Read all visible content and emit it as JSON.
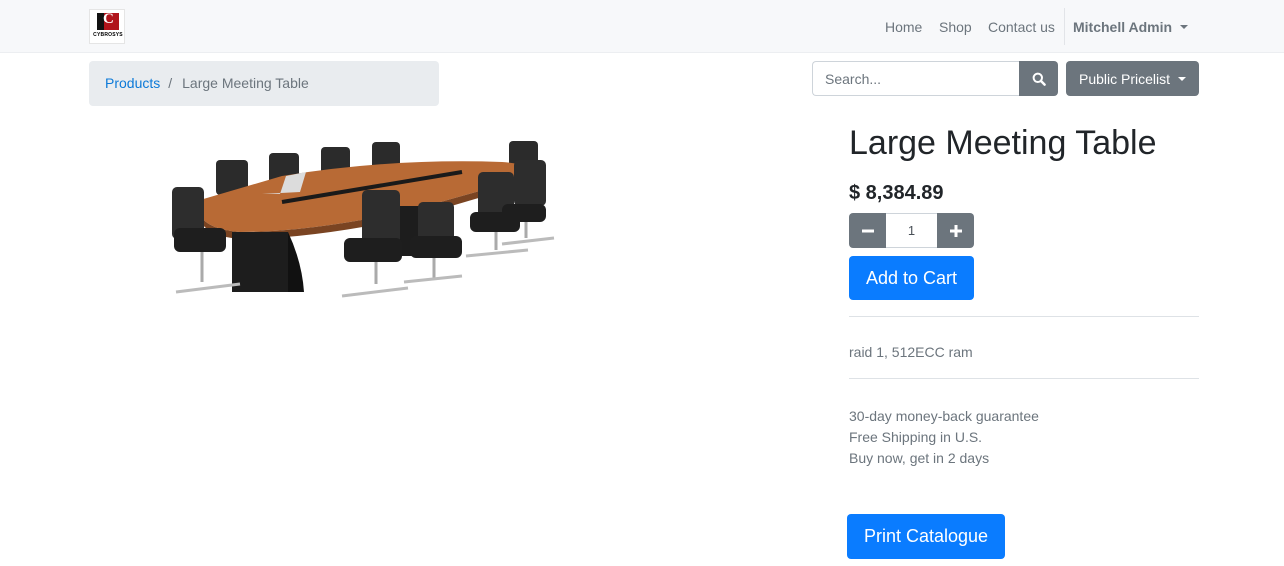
{
  "navbar": {
    "logo_text": "CYBROSYS",
    "links": [
      {
        "label": "Home"
      },
      {
        "label": "Shop"
      },
      {
        "label": "Contact us"
      }
    ],
    "user_name": "Mitchell Admin"
  },
  "breadcrumb": {
    "parent": "Products",
    "separator": "/",
    "current": "Large Meeting Table"
  },
  "search": {
    "placeholder": "Search...",
    "value": ""
  },
  "pricelist": {
    "selected": "Public Pricelist"
  },
  "product": {
    "name": "Large Meeting Table",
    "price": "$ 8,384.89",
    "quantity": "1",
    "add_to_cart_label": "Add to Cart",
    "description": "raid 1, 512ECC ram",
    "terms": [
      "30-day money-back guarantee",
      "Free Shipping in U.S.",
      "Buy now, get in 2 days"
    ],
    "print_label": "Print Catalogue"
  },
  "colors": {
    "primary": "#0a7cff",
    "secondary": "#6c757d",
    "logo_red": "#b0141b",
    "table_wood": "#b86a35"
  },
  "icons": [
    "search-icon",
    "minus-icon",
    "plus-icon",
    "caret-down-icon"
  ]
}
